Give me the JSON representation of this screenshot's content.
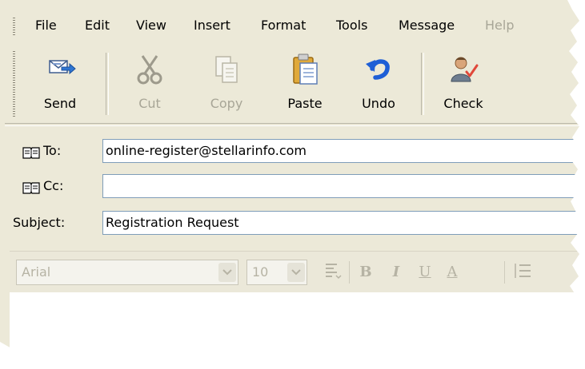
{
  "menu": {
    "file": "File",
    "edit": "Edit",
    "view": "View",
    "insert": "Insert",
    "format": "Format",
    "tools": "Tools",
    "message": "Message",
    "help": "Help"
  },
  "toolbar": {
    "send": "Send",
    "cut": "Cut",
    "copy": "Copy",
    "paste": "Paste",
    "undo": "Undo",
    "check": "Check"
  },
  "header": {
    "to_label": "To:",
    "to_value": "online-register@stellarinfo.com",
    "cc_label": "Cc:",
    "cc_value": "",
    "subject_label": "Subject:",
    "subject_value": "Registration Request"
  },
  "format_bar": {
    "font": "Arial",
    "size": "10",
    "bold": "B",
    "italic": "I",
    "underline": "U",
    "font_color": "A"
  },
  "colors": {
    "window_bg": "#ece9d8",
    "field_border": "#7f9db9",
    "disabled_text": "#a8a697",
    "undo_blue": "#1e5fd6"
  }
}
